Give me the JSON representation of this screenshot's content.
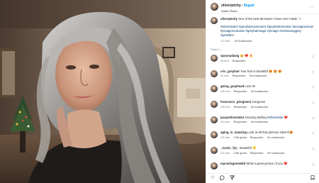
{
  "post": {
    "username": "oliverjetchy",
    "separator": "•",
    "follow_label": "Seguir",
    "location": "Sutton Place",
    "more_label": "···"
  },
  "caption": {
    "username": "oliverjetchy",
    "text": "One of the best decisions I have ever made 🤍",
    "hashtags": "#silversisters #greyhairmovement #greyhairtransition #proagewoman #proagerevolution #greyhairmagic #proage #embracinggrey #growthre",
    "time": "112 sem",
    "translate": "Ver traducción"
  },
  "sort_label": "Para ti ⌄",
  "comments": [
    {
      "user": "spoonydawg",
      "text": "😸 ❤️ 🔥",
      "time": "95 sem",
      "reply": "Responder",
      "likes": "",
      "translate": ""
    },
    {
      "user": "cris_greyhair",
      "text": "Your hair is beautiful 😍 🤩 😍",
      "time": "94 sem",
      "reply": "Responder",
      "likes": "",
      "translate": "Ver traducción"
    },
    {
      "user": "going_grayhead",
      "text": "Love it!!",
      "time": "106 sem",
      "reply": "Responder",
      "likes": "",
      "translate": "Ver traducción"
    },
    {
      "user": "francesco_piergianni",
      "text": "Gorgeous",
      "time": "106 sem",
      "reply": "Responder",
      "likes": "",
      "translate": "Ver traducción"
    },
    {
      "user": "jacquelinec5424",
      "text": "Amazing darling",
      "mention": "#silversister",
      "emoji": "❤️",
      "time": "110 sem",
      "reply": "Responder",
      "likes": "",
      "translate": "Ver traducción"
    },
    {
      "user": "aging_is_amazing",
      "text": "Look at all that glorious silver!!!🤩",
      "time": "111 sem",
      "reply": "Responder",
      "likes": "1 Me gusta",
      "translate": "Ver traducción"
    },
    {
      "user": "_iconic_fyn_",
      "text": "Beautiful 💛",
      "time": "111 sem",
      "reply": "Responder",
      "likes": "1 Me gusta",
      "translate": "Ver traducción"
    },
    {
      "user": "mycurlsgonewild",
      "text": "What a great picture of you ❤️",
      "time": "",
      "reply": "",
      "likes": "",
      "translate": ""
    }
  ],
  "footer": {
    "like_icon": "heart-icon",
    "comment_icon": "comment-icon",
    "share_icon": "share-icon",
    "save_icon": "bookmark-icon"
  }
}
